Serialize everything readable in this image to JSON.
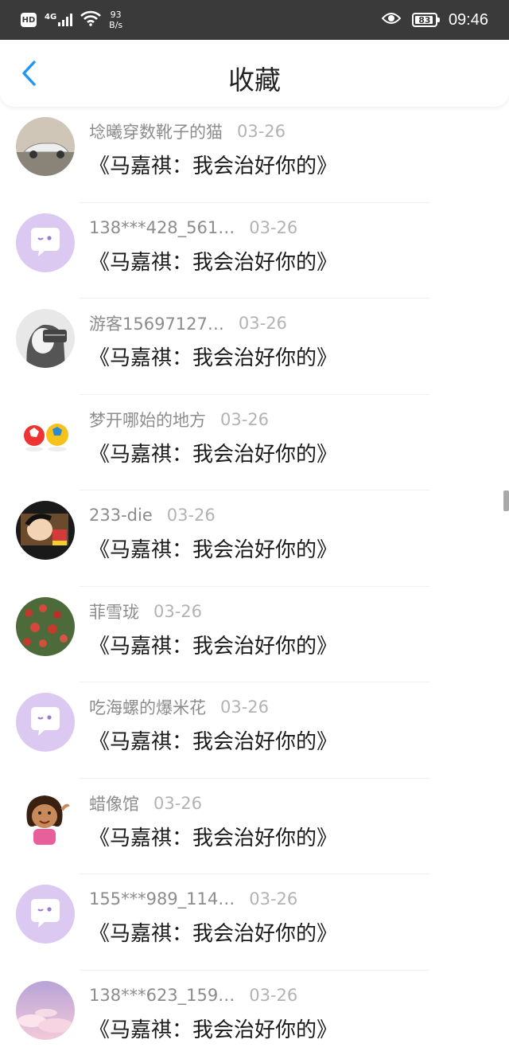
{
  "status_bar": {
    "hd": "HD",
    "network": "4G",
    "speed_value": "93",
    "speed_unit": "B/s",
    "battery": "83",
    "time": "09:46",
    "icons": [
      "hd-icon",
      "signal-icon",
      "wifi-icon",
      "eye-icon",
      "battery-icon"
    ]
  },
  "header": {
    "title": "收藏",
    "back_icon": "chevron-left-icon",
    "accent_color": "#2196F3"
  },
  "list": [
    {
      "user": "埝曦穿数靴子的猫",
      "date": "03-26",
      "title": "《马嘉祺：我会治好你的》",
      "avatar": "car"
    },
    {
      "user": "138***428_561…",
      "date": "03-26",
      "title": "《马嘉祺：我会治好你的》",
      "avatar": "default-chat"
    },
    {
      "user": "游客15697127…",
      "date": "03-26",
      "title": "《马嘉祺：我会治好你的》",
      "avatar": "girl-photo"
    },
    {
      "user": "梦开哪始的地方",
      "date": "03-26",
      "title": "《马嘉祺：我会治好你的》",
      "avatar": "soccer-balls"
    },
    {
      "user": "233-die",
      "date": "03-26",
      "title": "《马嘉祺：我会治好你的》",
      "avatar": "cartoon-boy"
    },
    {
      "user": "菲雪珑",
      "date": "03-26",
      "title": "《马嘉祺：我会治好你的》",
      "avatar": "apple-tree"
    },
    {
      "user": "吃海螺的爆米花",
      "date": "03-26",
      "title": "《马嘉祺：我会治好你的》",
      "avatar": "default-chat"
    },
    {
      "user": "蜡像馆",
      "date": "03-26",
      "title": "《马嘉祺：我会治好你的》",
      "avatar": "cartoon-girl"
    },
    {
      "user": "155***989_114…",
      "date": "03-26",
      "title": "《马嘉祺：我会治好你的》",
      "avatar": "default-chat"
    },
    {
      "user": "138***623_159…",
      "date": "03-26",
      "title": "《马嘉祺：我会治好你的》",
      "avatar": "pink-sky"
    }
  ]
}
